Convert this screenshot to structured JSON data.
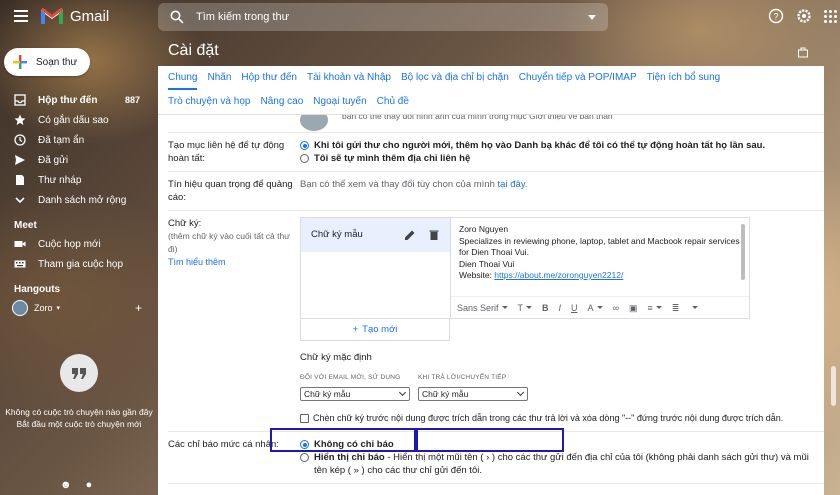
{
  "topbar": {
    "app_name": "Gmail",
    "search_placeholder": "Tìm kiếm trong thư"
  },
  "sidebar": {
    "compose_label": "Soạn thư",
    "items": [
      {
        "label": "Hộp thư đến",
        "count": "887",
        "icon": "inbox-icon"
      },
      {
        "label": "Có gắn dấu sao",
        "count": "",
        "icon": "star-icon"
      },
      {
        "label": "Đã tạm ẩn",
        "count": "",
        "icon": "clock-icon"
      },
      {
        "label": "Đã gửi",
        "count": "",
        "icon": "send-icon"
      },
      {
        "label": "Thư nháp",
        "count": "",
        "icon": "draft-icon"
      },
      {
        "label": "Danh sách mở rộng",
        "count": "",
        "icon": "chevron-down-icon"
      }
    ],
    "meet_title": "Meet",
    "meet_items": [
      {
        "label": "Cuộc họp mới",
        "icon": "video-icon"
      },
      {
        "label": "Tham gia cuộc họp",
        "icon": "keyboard-icon"
      }
    ],
    "hangouts_title": "Hangouts",
    "hangouts_user": "Zoro",
    "hangouts_empty_1": "Không có cuộc trò chuyện nào gần đây",
    "hangouts_empty_2": "Bắt đầu một cuộc trò chuyện mới"
  },
  "main": {
    "title": "Cài đặt",
    "tabs_row1": [
      "Chung",
      "Nhãn",
      "Hộp thư đến",
      "Tài khoản và Nhập",
      "Bộ lọc và địa chỉ bị chặn",
      "Chuyển tiếp và POP/IMAP",
      "Tiện ích bổ sung",
      "Trò chuyện và họp"
    ],
    "tabs_row2": [
      "Nâng cao",
      "Ngoại tuyến",
      "Chủ đề"
    ],
    "truncated_line": "bạn có thể thay đổi hình ảnh của mình trong mục Giới thiệu về bản thân",
    "contacts": {
      "label": "Tạo mục liên hệ để tự động hoàn tất:",
      "option1": "Khi tôi gửi thư cho người mới, thêm họ vào Danh bạ khác để tôi có thể tự động hoàn tất họ lần sau.",
      "option2": "Tôi sẽ tự mình thêm địa chỉ liên hệ"
    },
    "ads": {
      "label": "Tín hiệu quan trọng để quảng cáo:",
      "text": "Bạn có thể xem và thay đổi tùy chọn của mình",
      "link": "tại đây."
    },
    "signature": {
      "label": "Chữ ký:",
      "sub": "(thêm chữ ký vào cuối tất cả thư đi)",
      "learn_more": "Tìm hiểu thêm",
      "item_name": "Chữ ký mẫu",
      "lines": [
        "Zoro Nguyen",
        "Specializes in reviewing phone, laptop, tablet and Macbook repair services",
        "for Dien Thoai Vui.",
        "Dien Thoai Vui"
      ],
      "website_label": "Website:",
      "website_url": "https://about.me/zoronguyen2212/",
      "font": "Sans Serif",
      "new_label": "Tạo mới"
    },
    "defaults": {
      "title": "Chữ ký mặc định",
      "new_caption": "ĐỐI VỚI EMAIL MỚI, SỬ DỤNG",
      "reply_caption": "KHI TRẢ LỜI/CHUYỂN TIẾP",
      "new_value": "Chữ ký mẫu",
      "reply_value": "Chữ ký mẫu",
      "checkbox_text": "Chèn chữ ký trước nội dung được trích dẫn trong các thư trả lời và xóa dòng \"--\" đứng trước nội dung được trích dẫn."
    },
    "indicators": {
      "label": "Các chỉ báo mức cá nhân:",
      "option1": "Không có chỉ báo",
      "option2_bold": "Hiển thị chỉ báo",
      "option2_text": " - Hiển thị một mũi tên ( › ) cho các thư gửi đến địa chỉ của tôi (không phải danh sách gửi thư) và mũi tên kép ( » ) cho các thư chỉ gửi đến tôi."
    }
  },
  "colors": {
    "accent": "#1a73e8",
    "highlight": "#1a1ab0"
  }
}
